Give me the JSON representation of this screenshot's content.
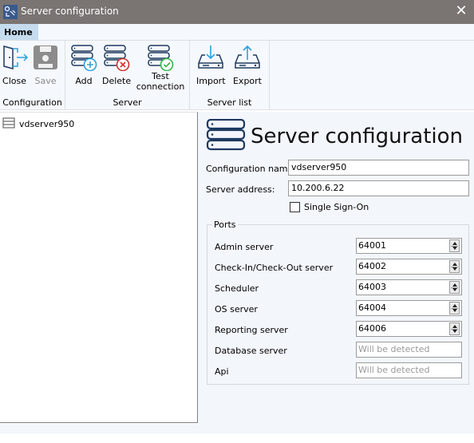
{
  "window": {
    "title": "Server configuration",
    "close_glyph": "✕"
  },
  "tabs": [
    {
      "label": "Home",
      "active": true
    }
  ],
  "ribbon": {
    "groups": [
      {
        "label": "Configuration",
        "buttons": [
          {
            "label": "Close",
            "icon": "exit-door-icon",
            "enabled": true
          },
          {
            "label": "Save",
            "icon": "floppy-disk-icon",
            "enabled": false
          }
        ]
      },
      {
        "label": "Server",
        "buttons": [
          {
            "label": "Add",
            "icon": "server-add-icon",
            "enabled": true
          },
          {
            "label": "Delete",
            "icon": "server-delete-icon",
            "enabled": true
          },
          {
            "label": "Test connection",
            "label_line1": "Test",
            "label_line2": "connection",
            "icon": "server-check-icon",
            "enabled": true
          }
        ]
      },
      {
        "label": "Server list",
        "buttons": [
          {
            "label": "Import",
            "icon": "drive-import-icon",
            "enabled": true
          },
          {
            "label": "Export",
            "icon": "drive-export-icon",
            "enabled": true
          }
        ]
      }
    ]
  },
  "tree": {
    "items": [
      {
        "label": "vdserver950",
        "icon": "server-list-icon"
      }
    ]
  },
  "form": {
    "heading": "Server configuration",
    "config_name_label": "Configuration name:",
    "config_name_value": "vdserver950",
    "server_address_label": "Server address:",
    "server_address_value": "10.200.6.22",
    "sso_label": "Single Sign-On",
    "sso_checked": false,
    "ports": {
      "legend": "Ports",
      "rows": [
        {
          "label": "Admin server",
          "value": "64001"
        },
        {
          "label": "Check-In/Check-Out server",
          "value": "64002"
        },
        {
          "label": "Scheduler",
          "value": "64003"
        },
        {
          "label": "OS server",
          "value": "64004"
        },
        {
          "label": "Reporting server",
          "value": "64006"
        },
        {
          "label": "Database server",
          "placeholder": "Will be detected"
        },
        {
          "label": "Api",
          "placeholder": "Will be detected"
        }
      ]
    }
  },
  "colors": {
    "titlebar": "#7a7473",
    "tab_active": "#c5dcef",
    "icon_navy": "#1e3a5f",
    "accent_blue": "#29a3e0",
    "delete_red": "#d32f2f",
    "check_green": "#2fb84a"
  }
}
